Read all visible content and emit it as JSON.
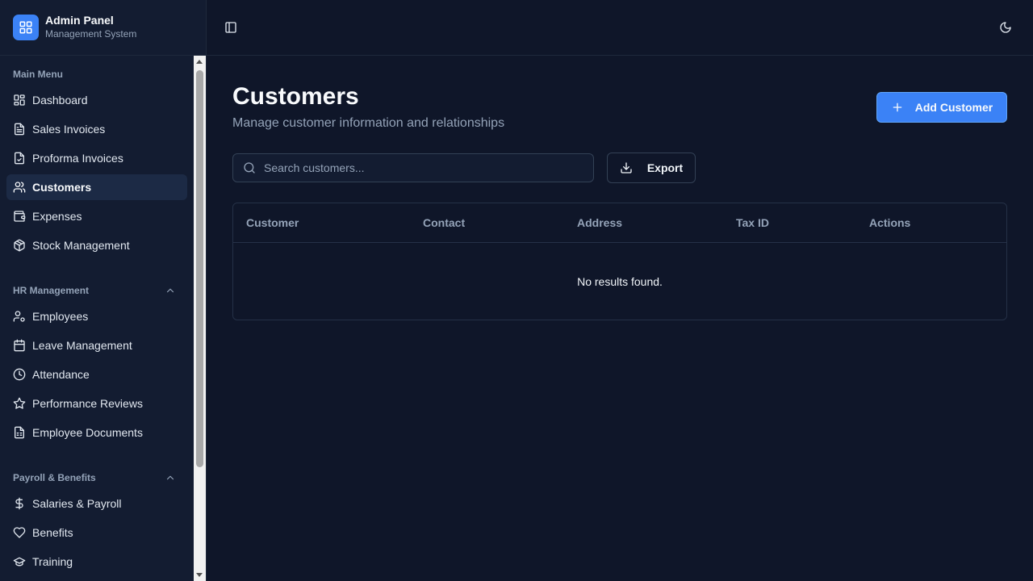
{
  "brand": {
    "title": "Admin Panel",
    "subtitle": "Management System",
    "icon": "layout-grid-icon"
  },
  "sidebar": {
    "groups": [
      {
        "label": "Main Menu",
        "collapsible": false,
        "items": [
          {
            "label": "Dashboard",
            "icon": "layout-dashboard-icon",
            "active": false
          },
          {
            "label": "Sales Invoices",
            "icon": "file-text-icon",
            "active": false
          },
          {
            "label": "Proforma Invoices",
            "icon": "file-check-icon",
            "active": false
          },
          {
            "label": "Customers",
            "icon": "users-icon",
            "active": true
          },
          {
            "label": "Expenses",
            "icon": "wallet-icon",
            "active": false
          },
          {
            "label": "Stock Management",
            "icon": "package-icon",
            "active": false
          }
        ]
      },
      {
        "label": "HR Management",
        "collapsible": true,
        "items": [
          {
            "label": "Employees",
            "icon": "user-cog-icon",
            "active": false
          },
          {
            "label": "Leave Management",
            "icon": "calendar-icon",
            "active": false
          },
          {
            "label": "Attendance",
            "icon": "clock-icon",
            "active": false
          },
          {
            "label": "Performance Reviews",
            "icon": "star-icon",
            "active": false
          },
          {
            "label": "Employee Documents",
            "icon": "file-spreadsheet-icon",
            "active": false
          }
        ]
      },
      {
        "label": "Payroll & Benefits",
        "collapsible": true,
        "items": [
          {
            "label": "Salaries & Payroll",
            "icon": "dollar-sign-icon",
            "active": false
          },
          {
            "label": "Benefits",
            "icon": "heart-icon",
            "active": false
          },
          {
            "label": "Training",
            "icon": "graduation-cap-icon",
            "active": false
          }
        ]
      }
    ]
  },
  "header": {
    "toggle_icon": "panel-left-icon",
    "theme_icon": "moon-icon"
  },
  "page": {
    "title": "Customers",
    "subtitle": "Manage customer information and relationships",
    "add_button": "Add Customer",
    "search_placeholder": "Search customers...",
    "search_value": "",
    "export_button": "Export"
  },
  "table": {
    "columns": [
      "Customer",
      "Contact",
      "Address",
      "Tax ID",
      "Actions"
    ],
    "rows": [],
    "empty_text": "No results found."
  },
  "colors": {
    "accent": "#3b82f6",
    "background": "#0f1629",
    "sidebar": "#131c31"
  }
}
